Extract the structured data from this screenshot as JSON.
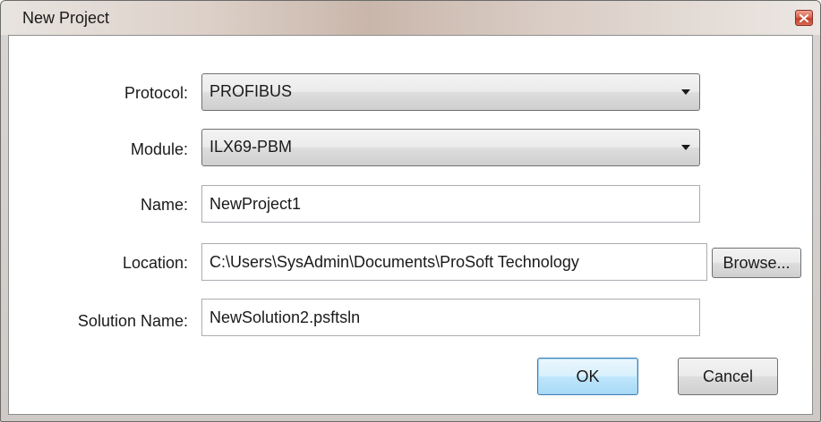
{
  "window": {
    "title": "New Project"
  },
  "form": {
    "protocol": {
      "label": "Protocol:",
      "selected": "PROFIBUS"
    },
    "module": {
      "label": "Module:",
      "selected": "ILX69-PBM"
    },
    "name": {
      "label": "Name:",
      "value": "NewProject1"
    },
    "location": {
      "label": "Location:",
      "value": "C:\\Users\\SysAdmin\\Documents\\ProSoft Technology",
      "browse_label": "Browse..."
    },
    "solution_name": {
      "label": "Solution Name:",
      "value": "NewSolution2.psftsln"
    }
  },
  "buttons": {
    "ok_label": "OK",
    "cancel_label": "Cancel"
  },
  "colors": {
    "default_button_border": "#3c7fb1",
    "close_button": "#c2402a"
  },
  "icons": {
    "close": "close-icon",
    "dropdown": "chevron-down-icon"
  }
}
